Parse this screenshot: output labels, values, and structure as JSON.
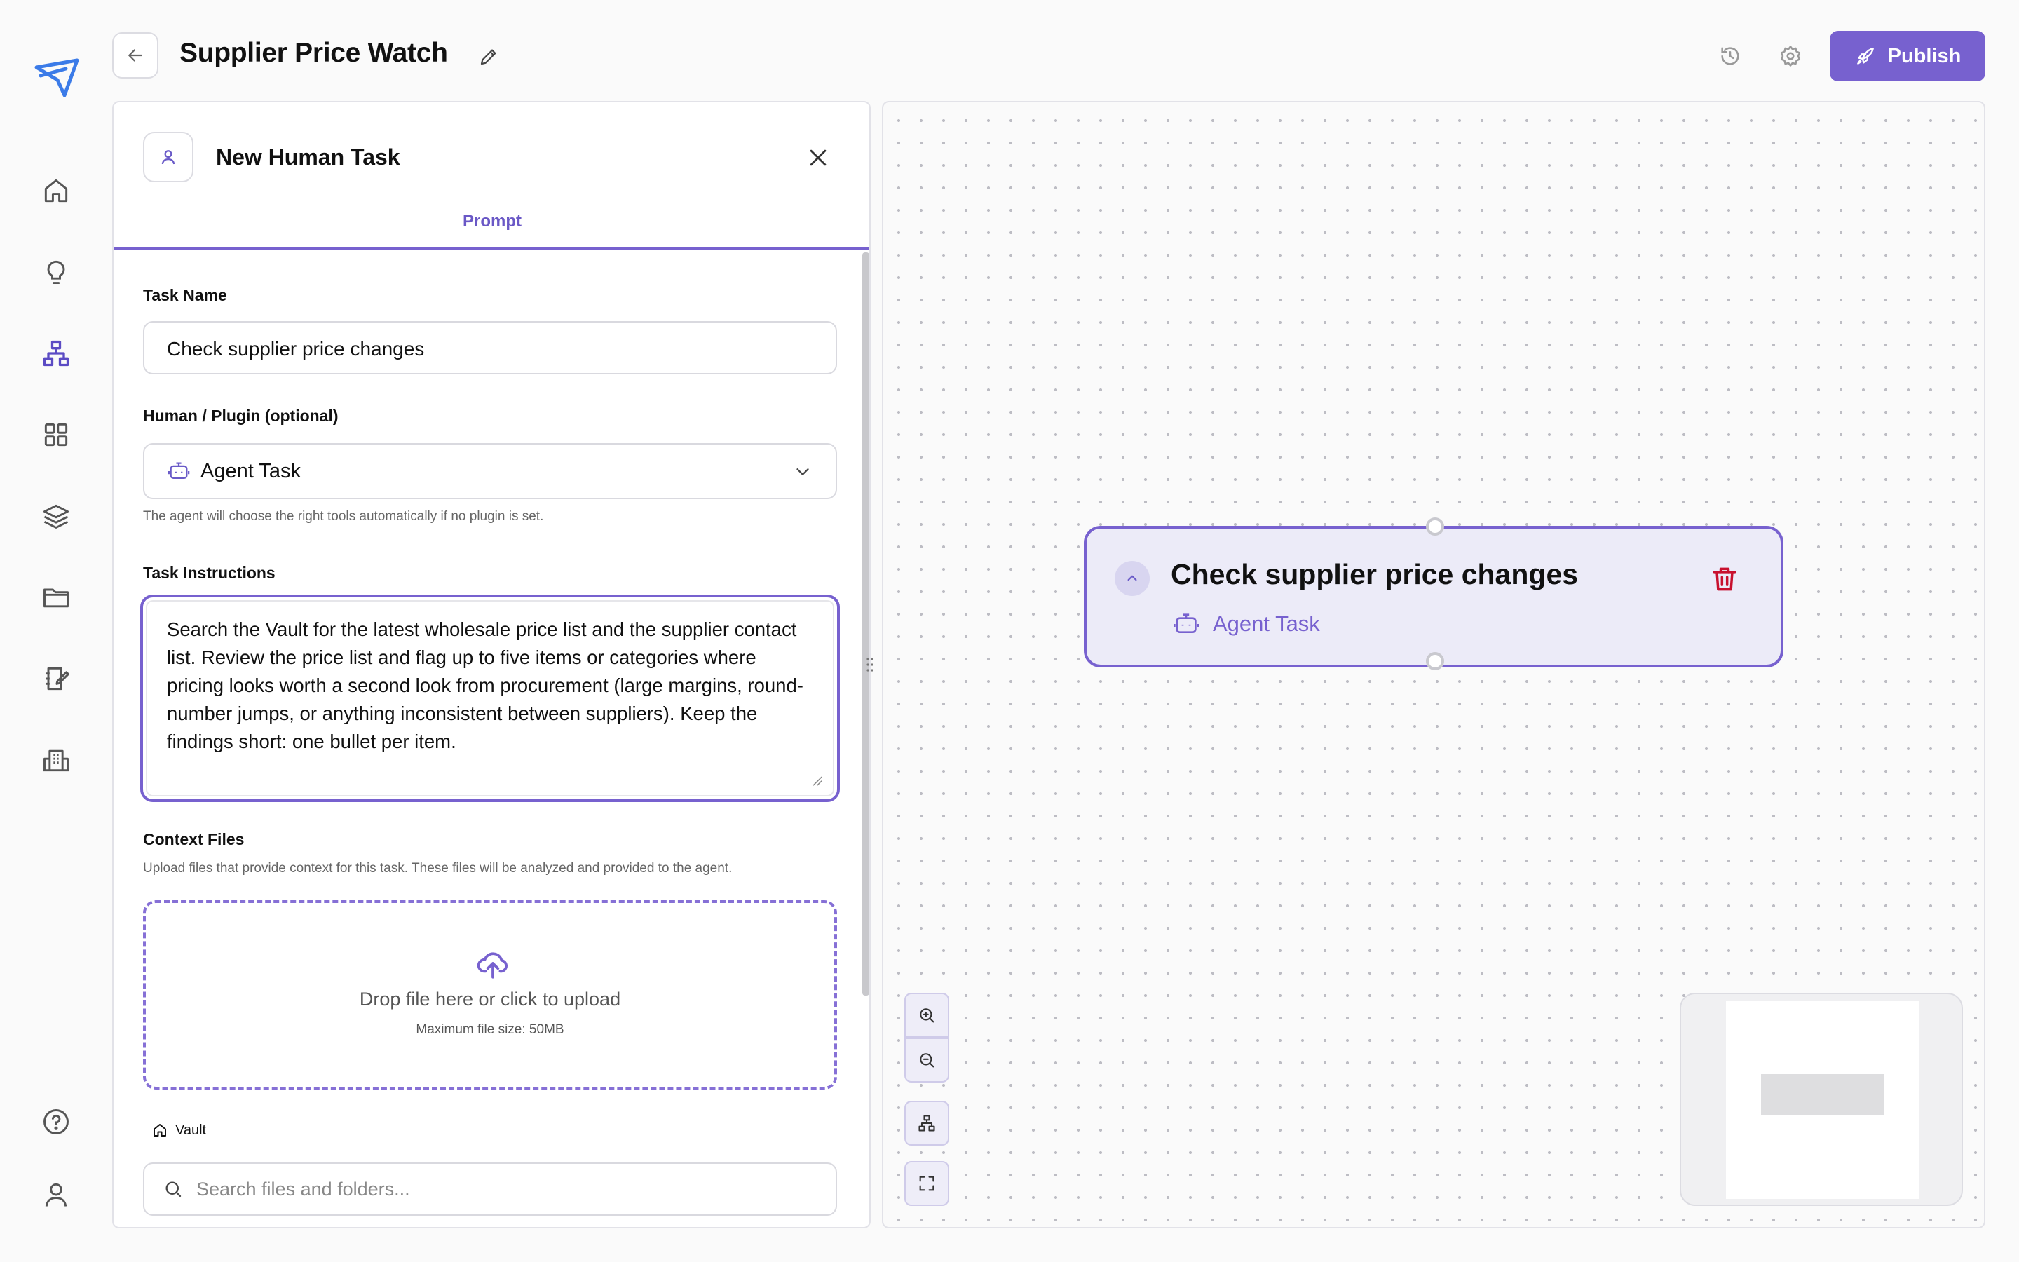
{
  "header": {
    "title": "Supplier Price Watch",
    "publish_label": "Publish"
  },
  "sidebar": {
    "items": [
      {
        "name": "home",
        "icon": "home-icon"
      },
      {
        "name": "ideas",
        "icon": "lightbulb-icon"
      },
      {
        "name": "workflows",
        "icon": "workflow-icon",
        "active": true
      },
      {
        "name": "apps",
        "icon": "grid-icon"
      },
      {
        "name": "layers",
        "icon": "layers-icon"
      },
      {
        "name": "files",
        "icon": "folder-icon"
      },
      {
        "name": "notes",
        "icon": "notebook-edit-icon"
      },
      {
        "name": "organization",
        "icon": "building-icon"
      }
    ],
    "bottom": [
      {
        "name": "help",
        "icon": "help-icon"
      },
      {
        "name": "profile",
        "icon": "user-icon"
      }
    ]
  },
  "panel": {
    "title": "New Human Task",
    "tab": "Prompt",
    "task_name_label": "Task Name",
    "task_name_value": "Check supplier price changes",
    "plugin_label": "Human / Plugin (optional)",
    "plugin_value": "Agent Task",
    "plugin_helper": "The agent will choose the right tools automatically if no plugin is set.",
    "instructions_label": "Task Instructions",
    "instructions_value": "Search the Vault for the latest wholesale price list and the supplier contact list. Review the price list and flag up to five items or categories where pricing looks worth a second look from procurement (large margins, round-number jumps, or anything inconsistent between suppliers). Keep the findings short: one bullet per item.",
    "context_label": "Context Files",
    "context_helper": "Upload files that provide context for this task. These files will be analyzed and provided to the agent.",
    "drop_text": "Drop file here or click to upload",
    "drop_sub": "Maximum file size: 50MB",
    "vault_label": "Vault",
    "search_placeholder": "Search files and folders..."
  },
  "canvas": {
    "node": {
      "title": "Check supplier price changes",
      "type": "Agent Task"
    }
  },
  "colors": {
    "accent": "#7761cf",
    "node_bg": "#ecebf8",
    "delete": "#c8102e"
  }
}
